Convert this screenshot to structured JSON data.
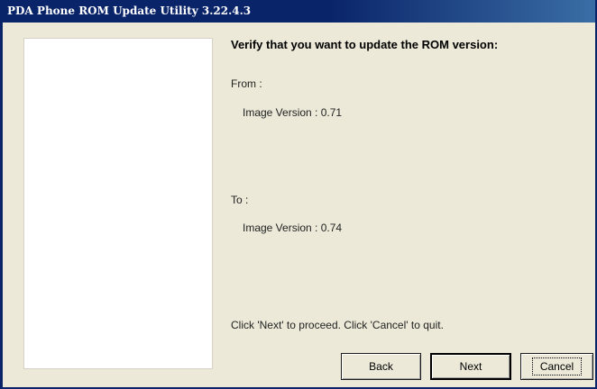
{
  "window": {
    "title": "PDA Phone ROM Update Utility 3.22.4.3"
  },
  "main": {
    "heading": "Verify that you want to update the ROM version:",
    "from_label": "From :",
    "from_version": "Image Version : 0.71",
    "to_label": "To :",
    "to_version": "Image Version : 0.74",
    "instruction": "Click 'Next' to proceed. Click 'Cancel' to quit."
  },
  "buttons": {
    "back": "Back",
    "next": "Next",
    "cancel": "Cancel"
  },
  "colors": {
    "titlebar": "#0a246a",
    "window_bg": "#ece9d8",
    "panel_bg": "#ffffff"
  }
}
